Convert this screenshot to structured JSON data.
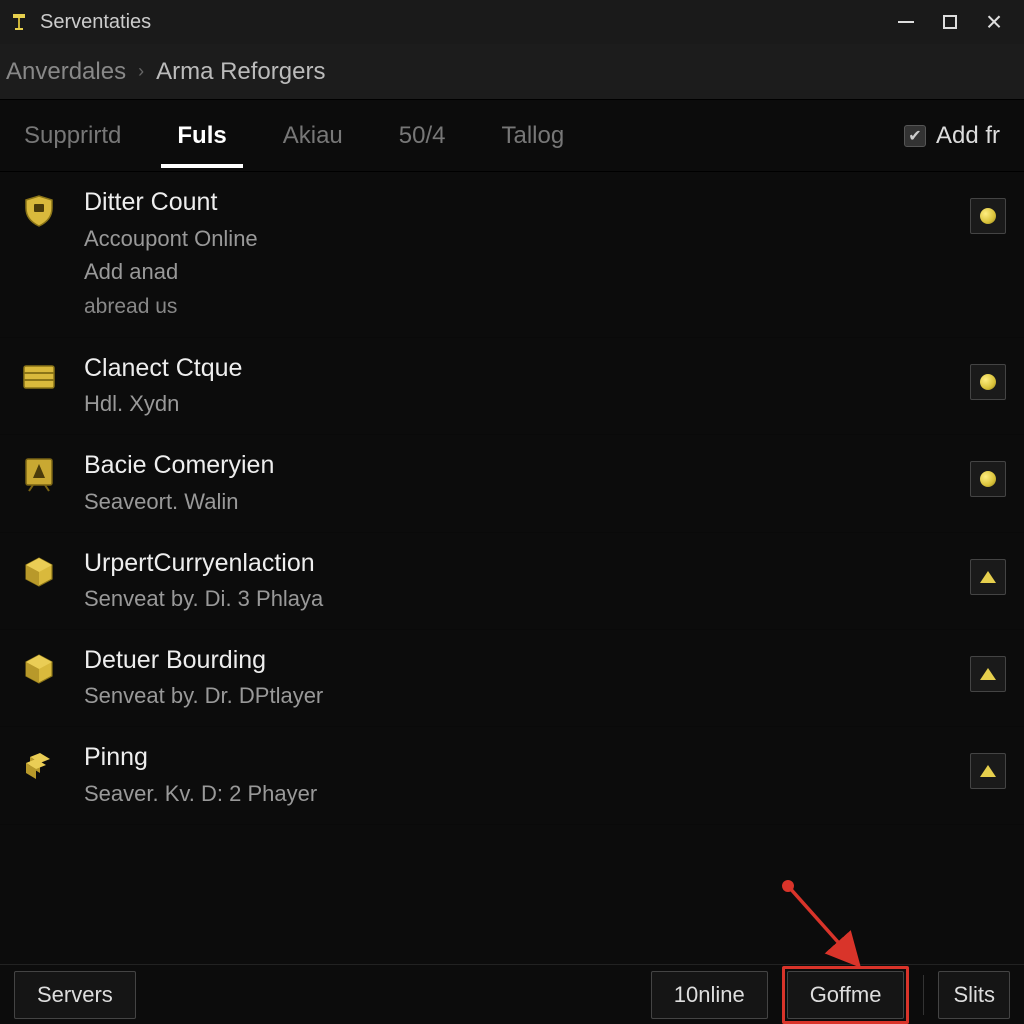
{
  "window": {
    "title": "Serventaties"
  },
  "breadcrumb": {
    "items": [
      "Anverdales",
      "Arma Reforgers"
    ]
  },
  "tabs": {
    "items": [
      {
        "label": "Supprirtd",
        "active": false
      },
      {
        "label": "Fuls",
        "active": true
      },
      {
        "label": "Akiau",
        "active": false
      },
      {
        "label": "50/4",
        "active": false
      },
      {
        "label": "Tallog",
        "active": false
      }
    ],
    "add_label": "Add fr"
  },
  "servers": [
    {
      "icon": "shield-icon",
      "title": "Ditter Count",
      "sub1": "Accoupont Online",
      "sub2": "Add anad",
      "sub3": "abread us",
      "badge": "dot"
    },
    {
      "icon": "crate-icon",
      "title": "Clanect Ctque",
      "sub1": "Hdl. Xydn",
      "badge": "dot"
    },
    {
      "icon": "frame-icon",
      "title": "Bacie Comeryien",
      "sub1": "Seaveort. Walin",
      "badge": "dot"
    },
    {
      "icon": "cube-icon",
      "title": "UrpertCurryenlaction",
      "sub1": "Senveat by. Di. 3 Phlaya",
      "badge": "arrow"
    },
    {
      "icon": "cube-icon",
      "title": "Detuer Bourding",
      "sub1": "Senveat by. Dr. DPtlayer",
      "badge": "arrow"
    },
    {
      "icon": "chips-icon",
      "title": "Pinng",
      "sub1": "Seaver. Kv. D: 2 Phayer",
      "badge": "arrow"
    }
  ],
  "bottom": {
    "servers_label": "Servers",
    "online_label": "10nline",
    "goffme_label": "Goffme",
    "slits_label": "Slits"
  },
  "colors": {
    "accent": "#e6cf4d",
    "highlight": "#d9342a"
  }
}
